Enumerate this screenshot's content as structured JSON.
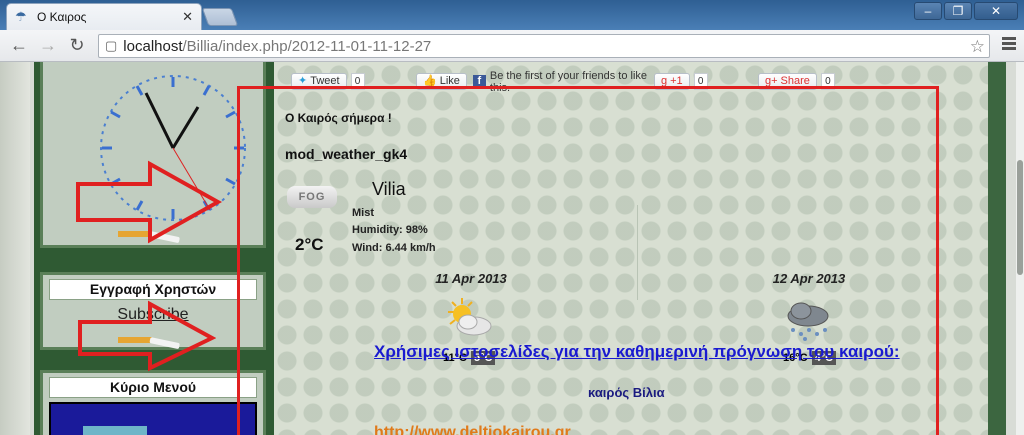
{
  "browser": {
    "tab_title": "Ο Καιρος",
    "url_host": "localhost",
    "url_path": "/Billia/index.php/2012-11-01-11-12-27"
  },
  "sidebar": {
    "register_title": "Εγγραφή Χρηστών",
    "subscribe_label": "Subscribe",
    "menu_title": "Κύριο Μενού"
  },
  "share": {
    "tweet_label": "Tweet",
    "tweet_count": "0",
    "like_label": "Like",
    "fb_text": "Be the first of your friends to like this.",
    "gplus_label": "+1",
    "gplus_count": "0",
    "gshare_label": "Share",
    "gshare_count": "0"
  },
  "weather": {
    "module_title": "Ο Καιρός σήμερα !",
    "module_name": "mod_weather_gk4",
    "icon_text": "FOG",
    "city": "Vilia",
    "condition": "Mist",
    "humidity": "Humidity: 98%",
    "wind": "Wind: 6.44 km/h",
    "temperature": "2°C",
    "forecast": [
      {
        "date": "11 Apr 2013",
        "high": "11°C",
        "low": "5°C",
        "icon": "sun-cloud-icon"
      },
      {
        "date": "12 Apr 2013",
        "high": "16°C",
        "low": "4°C",
        "icon": "rain-cloud-icon"
      }
    ],
    "footer_title": "καιρός Βίλια",
    "link_text": "Χρήσιμες ιστοσελίδες για την καθημερινή πρόγνωση του καιρού:",
    "link_url": "http://www.deltiokairou.gr"
  },
  "colors": {
    "annotation_red": "#e02020",
    "link_blue": "#1a1ad0",
    "link_orange": "#e07a1a"
  }
}
